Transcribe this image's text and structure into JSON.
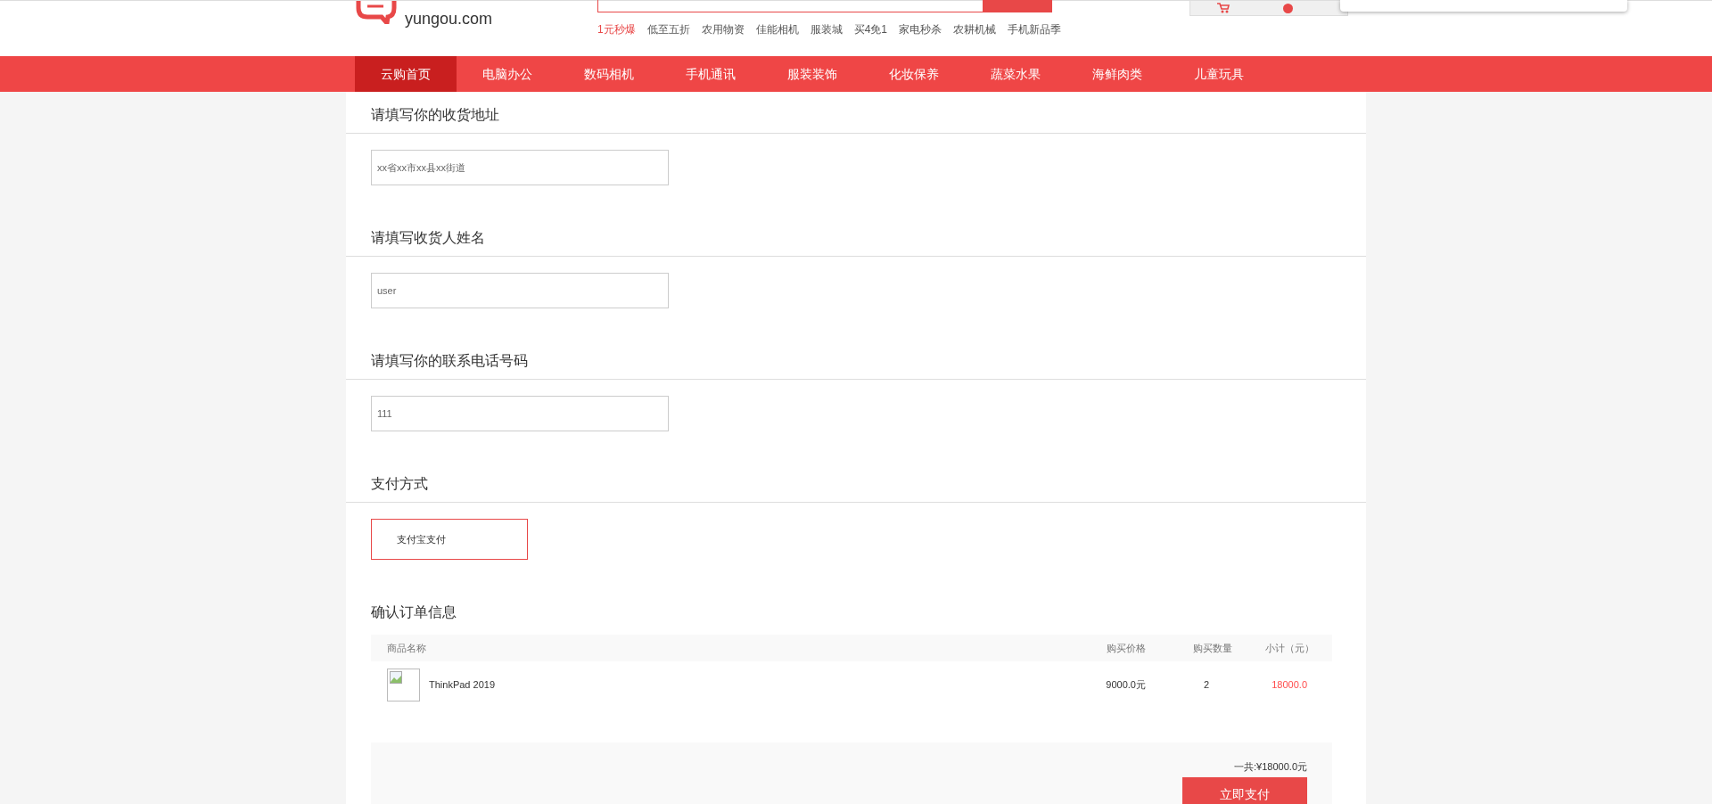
{
  "header": {
    "logo_domain": "yungou.com",
    "hot_links": [
      {
        "label": "1元秒爆",
        "highlighted": true
      },
      {
        "label": "低至五折",
        "highlighted": false
      },
      {
        "label": "农用物资",
        "highlighted": false
      },
      {
        "label": "佳能相机",
        "highlighted": false
      },
      {
        "label": "服装城",
        "highlighted": false
      },
      {
        "label": "买4免1",
        "highlighted": false
      },
      {
        "label": "家电秒杀",
        "highlighted": false
      },
      {
        "label": "农耕机械",
        "highlighted": false
      },
      {
        "label": "手机新品季",
        "highlighted": false
      }
    ]
  },
  "nav": [
    {
      "label": "云购首页",
      "selected": true
    },
    {
      "label": "电脑办公",
      "selected": false
    },
    {
      "label": "数码相机",
      "selected": false
    },
    {
      "label": "手机通讯",
      "selected": false
    },
    {
      "label": "服装装饰",
      "selected": false
    },
    {
      "label": "化妆保养",
      "selected": false
    },
    {
      "label": "蔬菜水果",
      "selected": false
    },
    {
      "label": "海鲜肉类",
      "selected": false
    },
    {
      "label": "儿童玩具",
      "selected": false
    }
  ],
  "sections": [
    {
      "kind": "input",
      "title": "请填写你的收货地址",
      "placeholder": "xx省xx市xx县xx街道"
    },
    {
      "kind": "input",
      "title": "请填写收货人姓名",
      "value": "user"
    },
    {
      "kind": "input",
      "title": "请填写你的联系电话号码",
      "value": "111"
    },
    {
      "kind": "payment",
      "title": "支付方式",
      "options": [
        {
          "label": "支付宝支付",
          "selected": true
        }
      ]
    }
  ],
  "order": {
    "title": "确认订单信息",
    "columns": [
      "商品名称",
      "购买价格",
      "购买数量",
      "小计（元）"
    ],
    "rows": [
      {
        "name": "ThinkPad 2019",
        "price": "9000.0元",
        "quantity": "2",
        "subtotal": "18000.0"
      }
    ],
    "total": "一共:¥18000.0元",
    "pay_button": "立即支付"
  }
}
